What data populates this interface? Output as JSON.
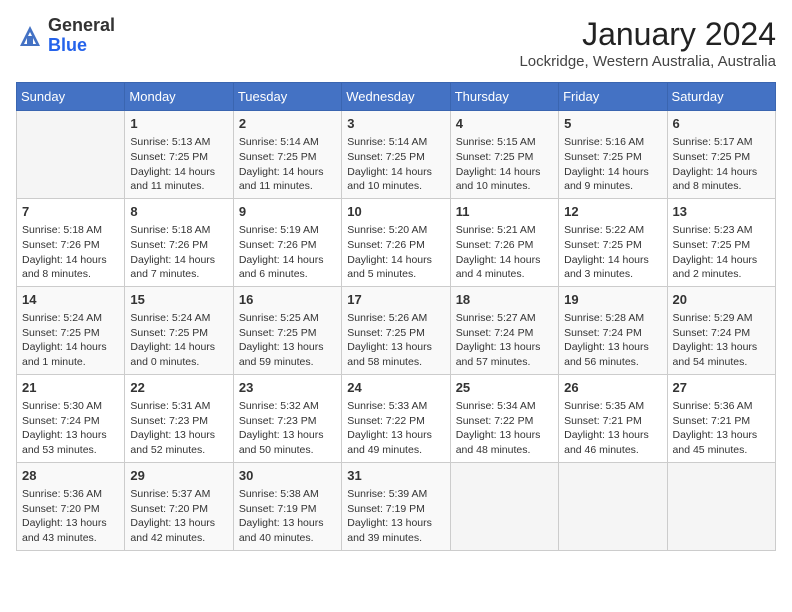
{
  "header": {
    "logo_general": "General",
    "logo_blue": "Blue",
    "month_title": "January 2024",
    "location": "Lockridge, Western Australia, Australia"
  },
  "calendar": {
    "days_of_week": [
      "Sunday",
      "Monday",
      "Tuesday",
      "Wednesday",
      "Thursday",
      "Friday",
      "Saturday"
    ],
    "weeks": [
      [
        {
          "day": "",
          "content": ""
        },
        {
          "day": "1",
          "content": "Sunrise: 5:13 AM\nSunset: 7:25 PM\nDaylight: 14 hours\nand 11 minutes."
        },
        {
          "day": "2",
          "content": "Sunrise: 5:14 AM\nSunset: 7:25 PM\nDaylight: 14 hours\nand 11 minutes."
        },
        {
          "day": "3",
          "content": "Sunrise: 5:14 AM\nSunset: 7:25 PM\nDaylight: 14 hours\nand 10 minutes."
        },
        {
          "day": "4",
          "content": "Sunrise: 5:15 AM\nSunset: 7:25 PM\nDaylight: 14 hours\nand 10 minutes."
        },
        {
          "day": "5",
          "content": "Sunrise: 5:16 AM\nSunset: 7:25 PM\nDaylight: 14 hours\nand 9 minutes."
        },
        {
          "day": "6",
          "content": "Sunrise: 5:17 AM\nSunset: 7:25 PM\nDaylight: 14 hours\nand 8 minutes."
        }
      ],
      [
        {
          "day": "7",
          "content": "Sunrise: 5:18 AM\nSunset: 7:26 PM\nDaylight: 14 hours\nand 8 minutes."
        },
        {
          "day": "8",
          "content": "Sunrise: 5:18 AM\nSunset: 7:26 PM\nDaylight: 14 hours\nand 7 minutes."
        },
        {
          "day": "9",
          "content": "Sunrise: 5:19 AM\nSunset: 7:26 PM\nDaylight: 14 hours\nand 6 minutes."
        },
        {
          "day": "10",
          "content": "Sunrise: 5:20 AM\nSunset: 7:26 PM\nDaylight: 14 hours\nand 5 minutes."
        },
        {
          "day": "11",
          "content": "Sunrise: 5:21 AM\nSunset: 7:26 PM\nDaylight: 14 hours\nand 4 minutes."
        },
        {
          "day": "12",
          "content": "Sunrise: 5:22 AM\nSunset: 7:25 PM\nDaylight: 14 hours\nand 3 minutes."
        },
        {
          "day": "13",
          "content": "Sunrise: 5:23 AM\nSunset: 7:25 PM\nDaylight: 14 hours\nand 2 minutes."
        }
      ],
      [
        {
          "day": "14",
          "content": "Sunrise: 5:24 AM\nSunset: 7:25 PM\nDaylight: 14 hours\nand 1 minute."
        },
        {
          "day": "15",
          "content": "Sunrise: 5:24 AM\nSunset: 7:25 PM\nDaylight: 14 hours\nand 0 minutes."
        },
        {
          "day": "16",
          "content": "Sunrise: 5:25 AM\nSunset: 7:25 PM\nDaylight: 13 hours\nand 59 minutes."
        },
        {
          "day": "17",
          "content": "Sunrise: 5:26 AM\nSunset: 7:25 PM\nDaylight: 13 hours\nand 58 minutes."
        },
        {
          "day": "18",
          "content": "Sunrise: 5:27 AM\nSunset: 7:24 PM\nDaylight: 13 hours\nand 57 minutes."
        },
        {
          "day": "19",
          "content": "Sunrise: 5:28 AM\nSunset: 7:24 PM\nDaylight: 13 hours\nand 56 minutes."
        },
        {
          "day": "20",
          "content": "Sunrise: 5:29 AM\nSunset: 7:24 PM\nDaylight: 13 hours\nand 54 minutes."
        }
      ],
      [
        {
          "day": "21",
          "content": "Sunrise: 5:30 AM\nSunset: 7:24 PM\nDaylight: 13 hours\nand 53 minutes."
        },
        {
          "day": "22",
          "content": "Sunrise: 5:31 AM\nSunset: 7:23 PM\nDaylight: 13 hours\nand 52 minutes."
        },
        {
          "day": "23",
          "content": "Sunrise: 5:32 AM\nSunset: 7:23 PM\nDaylight: 13 hours\nand 50 minutes."
        },
        {
          "day": "24",
          "content": "Sunrise: 5:33 AM\nSunset: 7:22 PM\nDaylight: 13 hours\nand 49 minutes."
        },
        {
          "day": "25",
          "content": "Sunrise: 5:34 AM\nSunset: 7:22 PM\nDaylight: 13 hours\nand 48 minutes."
        },
        {
          "day": "26",
          "content": "Sunrise: 5:35 AM\nSunset: 7:21 PM\nDaylight: 13 hours\nand 46 minutes."
        },
        {
          "day": "27",
          "content": "Sunrise: 5:36 AM\nSunset: 7:21 PM\nDaylight: 13 hours\nand 45 minutes."
        }
      ],
      [
        {
          "day": "28",
          "content": "Sunrise: 5:36 AM\nSunset: 7:20 PM\nDaylight: 13 hours\nand 43 minutes."
        },
        {
          "day": "29",
          "content": "Sunrise: 5:37 AM\nSunset: 7:20 PM\nDaylight: 13 hours\nand 42 minutes."
        },
        {
          "day": "30",
          "content": "Sunrise: 5:38 AM\nSunset: 7:19 PM\nDaylight: 13 hours\nand 40 minutes."
        },
        {
          "day": "31",
          "content": "Sunrise: 5:39 AM\nSunset: 7:19 PM\nDaylight: 13 hours\nand 39 minutes."
        },
        {
          "day": "",
          "content": ""
        },
        {
          "day": "",
          "content": ""
        },
        {
          "day": "",
          "content": ""
        }
      ]
    ]
  }
}
